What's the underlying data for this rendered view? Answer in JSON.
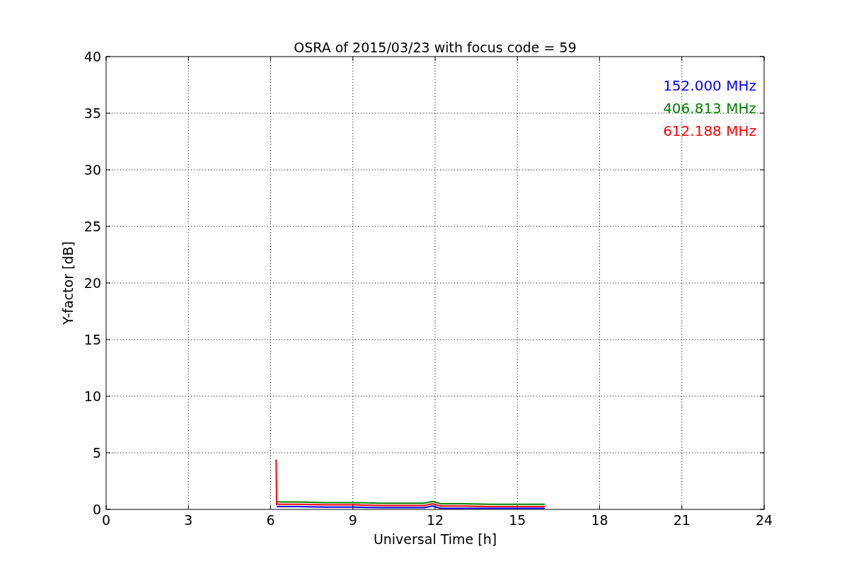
{
  "chart_data": {
    "type": "line",
    "title": "OSRA of 2015/03/23 with focus code = 59",
    "xlabel": "Universal Time [h]",
    "ylabel": "Y-factor [dB]",
    "x": [
      6.2,
      6.22,
      7,
      8,
      9,
      10,
      11,
      11.6,
      11.9,
      12.2,
      13,
      14,
      15,
      16
    ],
    "series": [
      {
        "name": "152.000 MHz",
        "color": "#0000ff",
        "values": [
          null,
          0.25,
          0.25,
          0.2,
          0.2,
          0.15,
          0.15,
          0.15,
          0.3,
          0.1,
          0.1,
          0.1,
          0.1,
          0.1
        ]
      },
      {
        "name": "406.813 MHz",
        "color": "#008000",
        "values": [
          null,
          0.65,
          0.65,
          0.6,
          0.6,
          0.55,
          0.55,
          0.55,
          0.7,
          0.5,
          0.5,
          0.45,
          0.45,
          0.45
        ]
      },
      {
        "name": "612.188 MHz",
        "color": "#ff0000",
        "values": [
          4.4,
          0.45,
          0.45,
          0.4,
          0.4,
          0.35,
          0.35,
          0.35,
          0.5,
          0.3,
          0.3,
          0.25,
          0.25,
          0.25
        ]
      }
    ],
    "xlim": [
      0,
      24
    ],
    "ylim": [
      0,
      40
    ],
    "xticks": [
      0,
      3,
      6,
      9,
      12,
      15,
      18,
      21,
      24
    ],
    "yticks": [
      0,
      5,
      10,
      15,
      20,
      25,
      30,
      35,
      40
    ],
    "grid": true
  }
}
